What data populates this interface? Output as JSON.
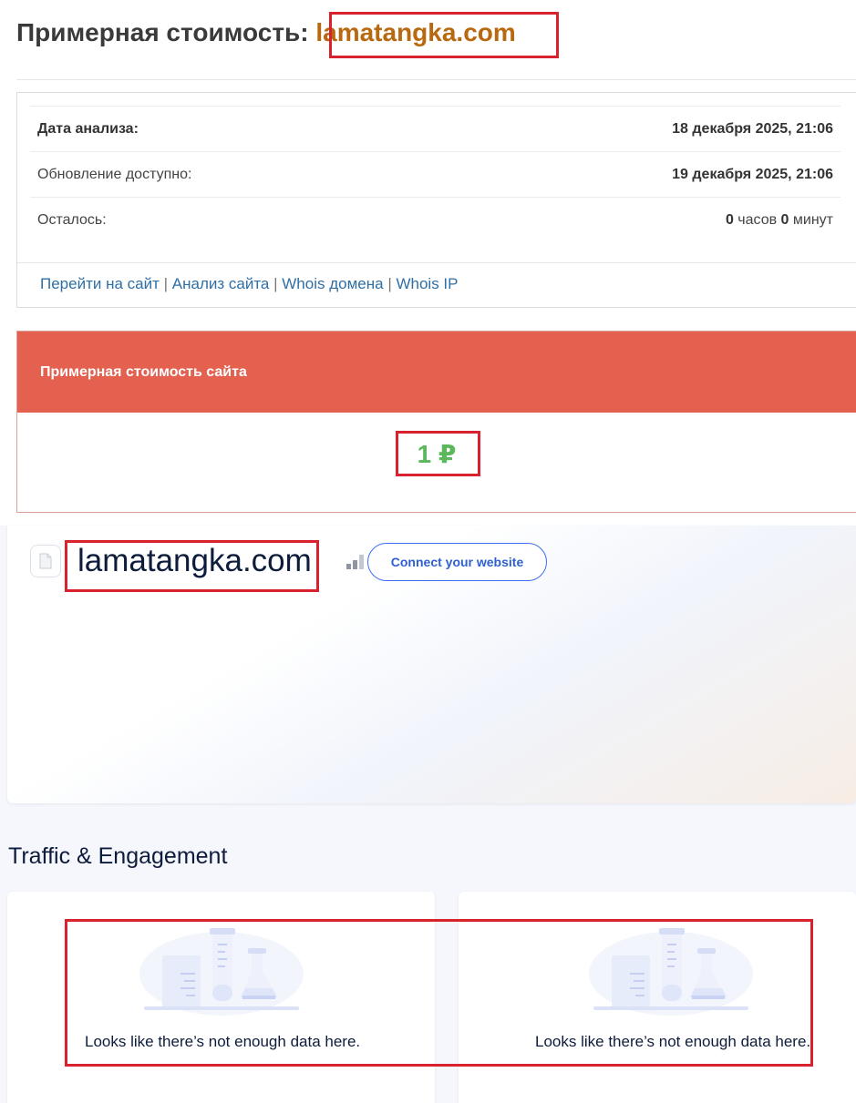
{
  "header": {
    "title_prefix": "Примерная стоимость:",
    "domain": "lamatangka.com"
  },
  "analysis": {
    "rows": [
      {
        "label": "Дата анализа:",
        "value": "18 декабря 2025, 21:06"
      },
      {
        "label": "Обновление доступно:",
        "value": "19 декабря 2025, 21:06"
      }
    ],
    "remaining": {
      "label": "Осталось:",
      "hours": "0",
      "hours_unit": " часов ",
      "minutes": "0",
      "minutes_unit": " минут"
    },
    "links": [
      "Перейти на сайт",
      "Анализ сайта",
      "Whois домена",
      "Whois IP"
    ],
    "separator": " | "
  },
  "cost": {
    "heading": "Примерная стоимость сайта",
    "value": "1 ₽"
  },
  "site_card": {
    "name": "lamatangka.com",
    "connect_label": "Connect your website"
  },
  "traffic": {
    "title": "Traffic & Engagement",
    "empty_message": "Looks like there’s not enough data here."
  },
  "colors": {
    "domain_accent": "#b8690f",
    "cost_header": "#e46150",
    "cost_value": "#5cb85c",
    "link": "#2f6fa5",
    "highlight_box": "#d8232e",
    "connect_button": "#3d6df2"
  }
}
